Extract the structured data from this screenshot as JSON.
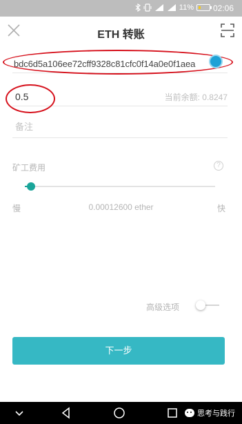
{
  "status_bar": {
    "battery": "11%",
    "time": "02:06",
    "icons": [
      "bluetooth-icon",
      "vibrate-icon",
      "signal-3g-icon",
      "signal-4g-icon",
      "battery-icon"
    ]
  },
  "header": {
    "title": "ETH 转账",
    "left_icon": "close-icon",
    "right_icon": "scan-icon"
  },
  "form": {
    "address": "bdc6d5a106ee72cff9328c81cfc0f14a0e0f1aea",
    "amount": "0.5",
    "balance_label": "当前余额: 0.8247",
    "memo_placeholder": "备注",
    "fee_label": "矿工费用",
    "fee_slider_level_pct": 3,
    "slow_label": "慢",
    "fee_value": "0.00012600 ether",
    "fast_label": "快",
    "advanced_label": "高级选项",
    "advanced_enabled": false
  },
  "actions": {
    "next_label": "下一步"
  },
  "watermark": {
    "text": "思考与践行"
  },
  "colors": {
    "accent": "#1aa59a",
    "button": "#36b8c4",
    "annotation": "#d6111c"
  }
}
